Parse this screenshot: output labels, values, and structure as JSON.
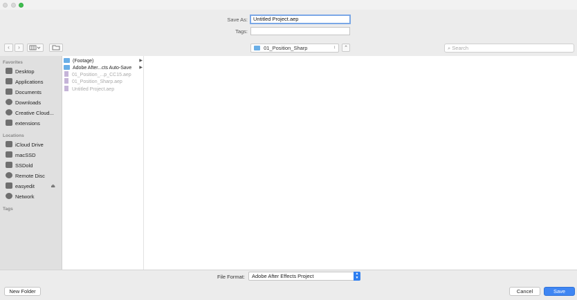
{
  "window": {},
  "save_as": {
    "label": "Save As:",
    "value": "Untitled Project.aep"
  },
  "tags": {
    "label": "Tags:",
    "value": ""
  },
  "toolbar": {
    "back_icon": "chevron-left-icon",
    "forward_icon": "chevron-right-icon",
    "view_icon": "columns-view-icon",
    "new_folder_icon": "folder-icon",
    "location": "01_Position_Sharp",
    "expand_icon": "chevron-up-icon",
    "search_placeholder": "Search"
  },
  "sidebar": {
    "favorites_header": "Favorites",
    "favorites": [
      {
        "label": "Desktop",
        "icon": "desktop-icon"
      },
      {
        "label": "Applications",
        "icon": "applications-icon"
      },
      {
        "label": "Documents",
        "icon": "documents-icon"
      },
      {
        "label": "Downloads",
        "icon": "downloads-icon"
      },
      {
        "label": "Creative Cloud...",
        "icon": "creative-cloud-icon"
      },
      {
        "label": "extensions",
        "icon": "folder-icon"
      }
    ],
    "locations_header": "Locations",
    "locations": [
      {
        "label": "iCloud Drive",
        "icon": "cloud-icon"
      },
      {
        "label": "macSSD",
        "icon": "disk-icon"
      },
      {
        "label": "SSDold",
        "icon": "disk-icon"
      },
      {
        "label": "Remote Disc",
        "icon": "disc-icon"
      },
      {
        "label": "easyedit",
        "icon": "disk-icon",
        "eject": "⏏"
      },
      {
        "label": "Network",
        "icon": "network-icon"
      }
    ],
    "tags_header": "Tags"
  },
  "files": [
    {
      "name": "(Footage)",
      "type": "folder",
      "has_children": true
    },
    {
      "name": "Adobe After...cts Auto-Save",
      "type": "folder",
      "has_children": true
    },
    {
      "name": "01_Position_...p_CC15.aep",
      "type": "aep",
      "dimmed": true
    },
    {
      "name": "01_Position_Sharp.aep",
      "type": "aep",
      "dimmed": true
    },
    {
      "name": "Untitled Project.aep",
      "type": "aep",
      "dimmed": true
    }
  ],
  "file_format": {
    "label": "File Format:",
    "value": "Adobe After Effects Project"
  },
  "buttons": {
    "new_folder": "New Folder",
    "cancel": "Cancel",
    "save": "Save"
  },
  "colors": {
    "accent": "#3f86f3",
    "folder": "#6aaee6",
    "sidebar_bg": "#e0e0e0"
  }
}
